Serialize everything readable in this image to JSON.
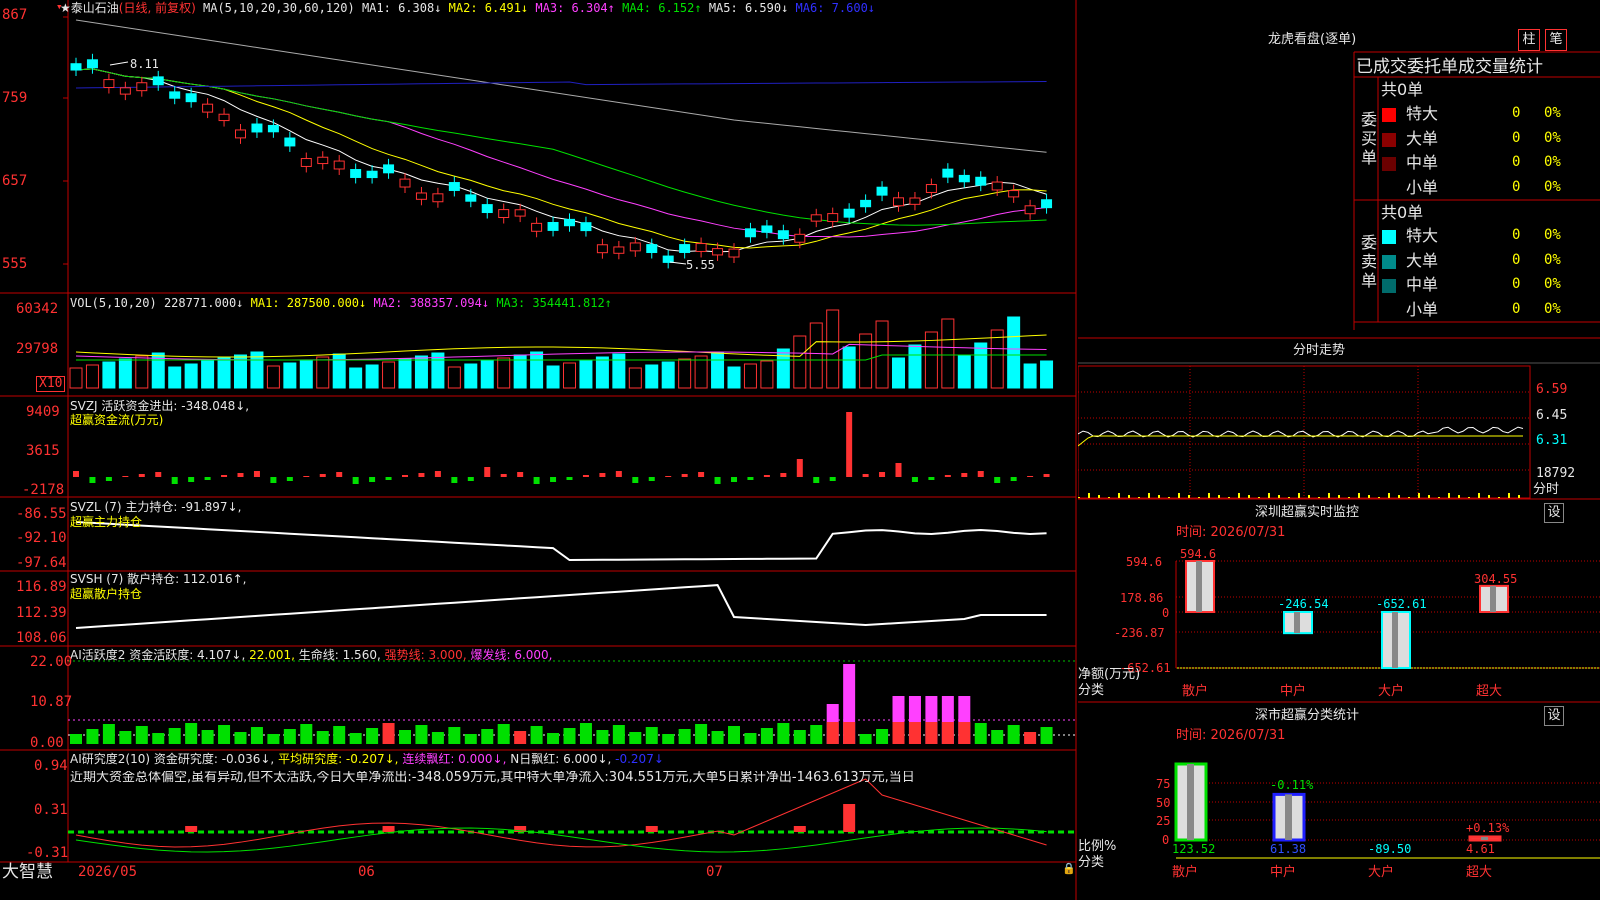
{
  "colors": {
    "up": "#ff3232",
    "down": "#00ffff",
    "grid": "#c00000",
    "ma1": "#ffffff",
    "ma2": "#ffff00",
    "ma3": "#ff40ff",
    "ma4": "#00e000",
    "ma5": "#aaaaaa",
    "ma6": "#2020c0"
  },
  "main": {
    "title": "★泰山石油",
    "subtitle": "(日线, 前复权)",
    "ma_label": "MA(5,10,20,30,60,120)",
    "ma1": "MA1: 6.308↓",
    "ma2": "MA2: 6.491↓",
    "ma3": "MA3: 6.304↑",
    "ma4": "MA4: 6.152↑",
    "ma5": "MA5: 6.590↓",
    "ma6": "MA6: 7.600↓",
    "axis": [
      "867",
      "759",
      "657",
      "555"
    ],
    "high_note": "8.11",
    "low_note": "5.55"
  },
  "vol": {
    "label": "VOL(5,10,20)",
    "v": "228771.000↓",
    "ma1": "MA1: 287500.000↓",
    "ma2": "MA2: 388357.094↓",
    "ma3": "MA3: 354441.812↑",
    "axis": [
      "60342",
      "29798"
    ],
    "unit": "X10"
  },
  "svzj": {
    "label": "SVZJ  活跃资金进出: -348.048↓,",
    "sub": "超赢资金流(万元)",
    "axis": [
      "9409",
      "3615",
      "-2178"
    ]
  },
  "svzl": {
    "label": "SVZL (7) 主力持仓: -91.897↓,",
    "sub": "超赢主力持仓",
    "axis": [
      "-86.55",
      "-92.10",
      "-97.64"
    ]
  },
  "svsh": {
    "label": "SVSH (7) 散户持仓: 112.016↑,",
    "sub": "超赢散户持仓",
    "axis": [
      "116.89",
      "112.39",
      "108.06"
    ]
  },
  "ai1": {
    "a": "AI活跃度2 资金活跃度: 4.107↓,",
    "b": "22.001,",
    "c": "生命线: 1.560,",
    "d": "强势线: 3.000,",
    "e": "爆发线: 6.000,",
    "axis": [
      "22.00",
      "10.87",
      "0.00"
    ]
  },
  "ai2": {
    "a": "AI研究度2(10) 资金研究度: -0.036↓,",
    "b": "平均研究度: -0.207↓,",
    "c": "连续飘红: 0.000↓,",
    "d": "N日飘红: 6.000↓,",
    "e": "-0.207↓",
    "axis": [
      "0.94",
      "0.31",
      "-0.31"
    ],
    "text": "近期大资金总体偏空,虽有异动,但不太活跃,今日大单净流出:-348.059万元,其中特大单净流入:304.551万元,大单5日累计净出-1463.613万元,当日"
  },
  "dates": [
    "2026/05",
    "06",
    "07"
  ],
  "brand": "大智慧",
  "right": {
    "lhb_title": "龙虎看盘(逐单)",
    "btn1": "柱",
    "btn2": "笔",
    "header": "已成交委托单成交量统计",
    "buy": {
      "label": "委买单",
      "total": "共0单",
      "rows": [
        {
          "name": "特大",
          "n": "0",
          "p": "0%"
        },
        {
          "name": "大单",
          "n": "0",
          "p": "0%"
        },
        {
          "name": "中单",
          "n": "0",
          "p": "0%"
        },
        {
          "name": "小单",
          "n": "0",
          "p": "0%"
        }
      ]
    },
    "sell": {
      "label": "委卖单",
      "total": "共0单",
      "rows": [
        {
          "name": "特大",
          "n": "0",
          "p": "0%"
        },
        {
          "name": "大单",
          "n": "0",
          "p": "0%"
        },
        {
          "name": "中单",
          "n": "0",
          "p": "0%"
        },
        {
          "name": "小单",
          "n": "0",
          "p": "0%"
        }
      ]
    },
    "fs_title": "分时走势",
    "fs_axis": [
      "6.59",
      "6.45",
      "6.31"
    ],
    "fs_vol": "18792",
    "fs_vol_label": "分时",
    "sz_title": "深圳超赢实时监控",
    "sz_time": "时间: 2026/07/31",
    "set": "设",
    "sz_axis": [
      "594.6",
      "178.86",
      "0",
      "-236.87",
      "-652.61"
    ],
    "sz_vals": [
      {
        "name": "散户",
        "v": 594.6,
        "label": "594.6"
      },
      {
        "name": "中户",
        "v": -246.54,
        "label": "-246.54"
      },
      {
        "name": "大户",
        "v": -652.61,
        "label": "-652.61"
      },
      {
        "name": "超大",
        "v": 304.55,
        "label": "304.55"
      }
    ],
    "sz_ylabel": "净额(万元)",
    "sz_xlabel": "分类",
    "fl_title": "深市超赢分类统计",
    "fl_time": "时间: 2026/07/31",
    "fl_axis": [
      "75",
      "50",
      "25",
      "0"
    ],
    "fl_vals": [
      {
        "name": "散户",
        "pct": "",
        "val": "123.52",
        "h": 1.0
      },
      {
        "name": "中户",
        "pct": "-0.11%",
        "val": "61.38",
        "h": 0.6
      },
      {
        "name": "大户",
        "pct": "",
        "val": "-89.50",
        "h": 0
      },
      {
        "name": "超大",
        "pct": "+0.13%",
        "val": "4.61",
        "h": 0.04
      }
    ],
    "fl_ylabel": "比例%",
    "fl_xlabel": "分类"
  }
}
